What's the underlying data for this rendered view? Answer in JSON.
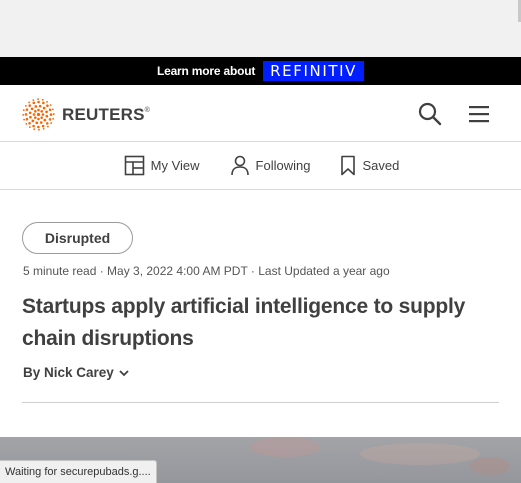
{
  "ad": {
    "learn_text": "Learn more about",
    "brand": "REFINITIV",
    "brand_color": "#001eff"
  },
  "header": {
    "brand": "REUTERS",
    "registered": "®",
    "logo_color": "#fa6400",
    "search_icon": "search-icon",
    "menu_icon": "hamburger-menu-icon"
  },
  "subnav": {
    "items": [
      {
        "label": "My View",
        "icon": "layout-icon"
      },
      {
        "label": "Following",
        "icon": "person-icon"
      },
      {
        "label": "Saved",
        "icon": "bookmark-icon"
      }
    ]
  },
  "article": {
    "tag": "Disrupted",
    "meta": "5 minute read · May 3, 2022 4:00 AM PDT · Last Updated a year ago",
    "headline": "Startups apply artificial intelligence to supply chain disruptions",
    "byline": "By Nick Carey"
  },
  "status_bar": {
    "text": "Waiting for securepubads.g...."
  }
}
